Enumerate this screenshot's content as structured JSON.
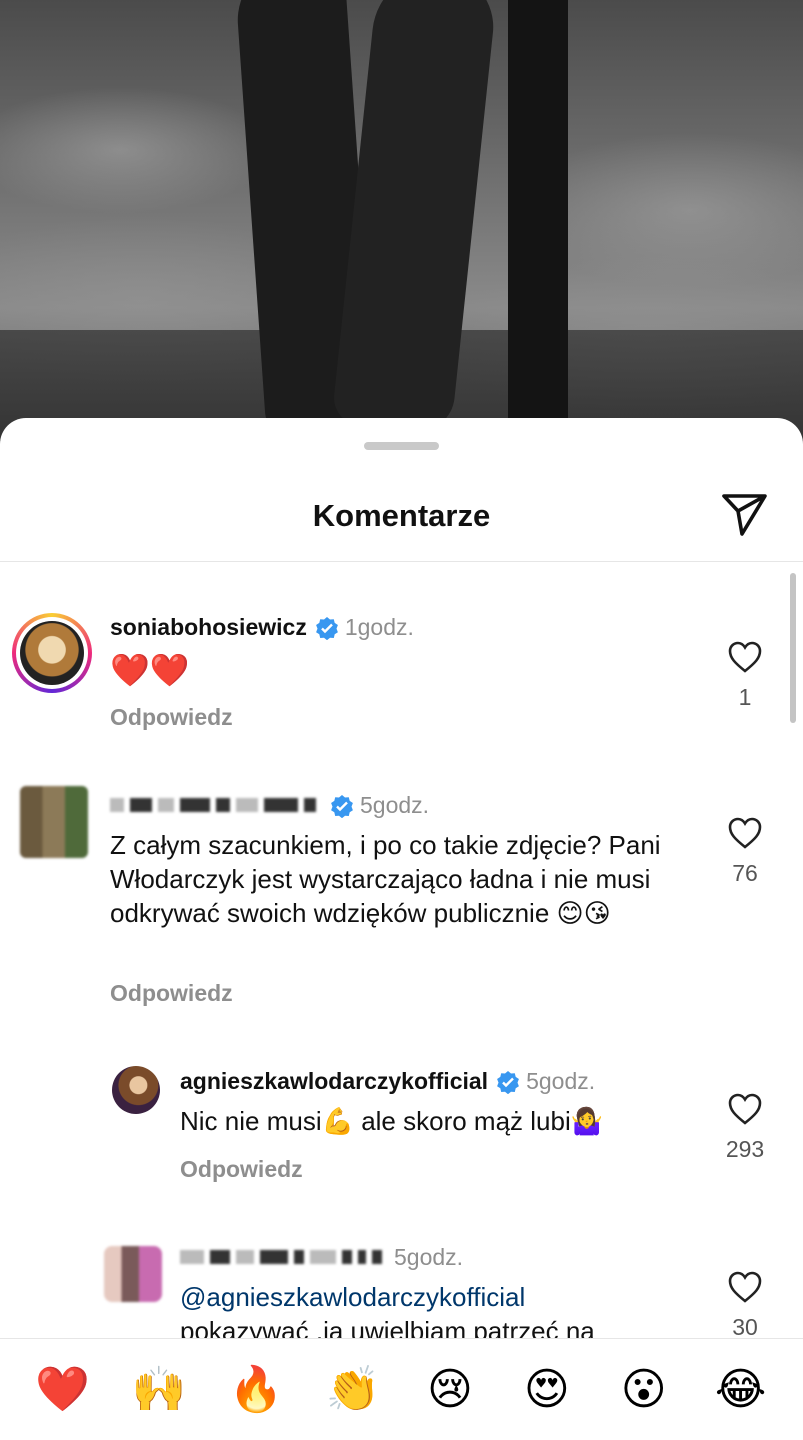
{
  "sheet": {
    "title": "Komentarze"
  },
  "comments": [
    {
      "username": "soniabohosiewicz",
      "time": "1godz.",
      "text": "❤️❤️",
      "reply": "Odpowiedz",
      "likes": "1"
    },
    {
      "username": "",
      "time": "5godz.",
      "text": "Z całym szacunkiem, i po co takie zdjęcie? Pani Włodarczyk jest wystarczająco ładna i nie musi odkrywać swoich wdzięków publicznie 😊😘",
      "reply": "Odpowiedz",
      "likes": "76"
    },
    {
      "username": "agnieszkawlodarczykofficial",
      "time": "5godz.",
      "text": "Nic nie musi💪 ale skoro mąż lubi🤷‍♀️",
      "reply": "Odpowiedz",
      "likes": "293"
    },
    {
      "username": "",
      "time": "5godz.",
      "mention": "@agnieszkawlodarczykofficial",
      "text": "pokazywać ,ja uwielbiam patrzeć na",
      "likes": "30"
    }
  ],
  "emoji_bar": [
    "❤️",
    "🙌",
    "🔥",
    "👏",
    "😢",
    "😍",
    "😮",
    "😂"
  ],
  "icons": {
    "send": "send-icon",
    "heart": "heart-outline-icon",
    "verified": "verified-badge-icon"
  },
  "colors": {
    "verified": "#3897f0",
    "mention": "#00376b",
    "muted": "#8e8e8e"
  }
}
